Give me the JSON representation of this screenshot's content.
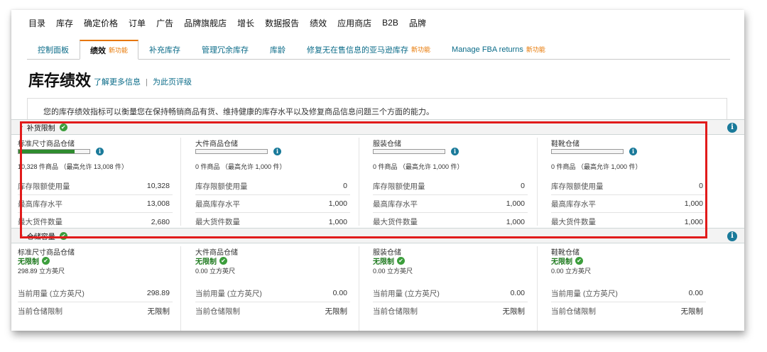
{
  "top_nav": [
    "目录",
    "库存",
    "确定价格",
    "订单",
    "广告",
    "品牌旗舰店",
    "增长",
    "数据报告",
    "绩效",
    "应用商店",
    "B2B",
    "品牌"
  ],
  "sub_tabs": [
    {
      "label": "控制面板",
      "badge": ""
    },
    {
      "label": "绩效",
      "badge": "新功能",
      "active": true
    },
    {
      "label": "补充库存",
      "badge": ""
    },
    {
      "label": "管理冗余库存",
      "badge": ""
    },
    {
      "label": "库龄",
      "badge": ""
    },
    {
      "label": "修复无在售信息的亚马逊库存",
      "badge": "新功能"
    },
    {
      "label": "Manage FBA returns",
      "badge": "新功能"
    }
  ],
  "page": {
    "title": "库存绩效",
    "link_more": "了解更多信息",
    "separator": "|",
    "link_rate": "为此页评级",
    "intro": "您的库存绩效指标可以衡量您在保持畅销商品有货、维持健康的库存水平以及修复商品信息问题三个方面的能力。"
  },
  "restock": {
    "title": "补货限制",
    "check_icon": "✔",
    "columns": [
      {
        "name": "标准尺寸商品仓储",
        "fill": 0.79,
        "summary": "10,328 件商品 （最高允许 13,008 件）",
        "metrics": [
          {
            "label": "库存限额使用量",
            "value": "10,328"
          },
          {
            "label": "最高库存水平",
            "value": "13,008"
          },
          {
            "label": "最大货件数量",
            "value": "2,680"
          }
        ]
      },
      {
        "name": "大件商品仓储",
        "fill": 0,
        "summary": "0 件商品 （最高允许 1,000 件）",
        "metrics": [
          {
            "label": "库存限额使用量",
            "value": "0"
          },
          {
            "label": "最高库存水平",
            "value": "1,000"
          },
          {
            "label": "最大货件数量",
            "value": "1,000"
          }
        ]
      },
      {
        "name": "服装仓储",
        "fill": 0,
        "summary": "0 件商品 （最高允许 1,000 件）",
        "metrics": [
          {
            "label": "库存限额使用量",
            "value": "0"
          },
          {
            "label": "最高库存水平",
            "value": "1,000"
          },
          {
            "label": "最大货件数量",
            "value": "1,000"
          }
        ]
      },
      {
        "name": "鞋靴仓储",
        "fill": 0,
        "summary": "0 件商品 （最高允许 1,000 件）",
        "metrics": [
          {
            "label": "库存限额使用量",
            "value": "0"
          },
          {
            "label": "最高库存水平",
            "value": "1,000"
          },
          {
            "label": "最大货件数量",
            "value": "1,000"
          }
        ]
      }
    ]
  },
  "storage": {
    "title": "仓储容量",
    "columns": [
      {
        "name": "标准尺寸商品仓储",
        "status": "无限制",
        "summary": "298.89 立方英尺",
        "metrics": [
          {
            "label": "当前用量 (立方英尺)",
            "value": "298.89"
          },
          {
            "label": "当前仓储限制",
            "value": "无限制"
          }
        ]
      },
      {
        "name": "大件商品仓储",
        "status": "无限制",
        "summary": "0.00 立方英尺",
        "metrics": [
          {
            "label": "当前用量 (立方英尺)",
            "value": "0.00"
          },
          {
            "label": "当前仓储限制",
            "value": "无限制"
          }
        ]
      },
      {
        "name": "服装仓储",
        "status": "无限制",
        "summary": "0.00 立方英尺",
        "metrics": [
          {
            "label": "当前用量 (立方英尺)",
            "value": "0.00"
          },
          {
            "label": "当前仓储限制",
            "value": "无限制"
          }
        ]
      },
      {
        "name": "鞋靴仓储",
        "status": "无限制",
        "summary": "0.00 立方英尺",
        "metrics": [
          {
            "label": "当前用量 (立方英尺)",
            "value": "0.00"
          },
          {
            "label": "当前仓储限制",
            "value": "无限制"
          }
        ]
      }
    ]
  },
  "icons": {
    "info": "i",
    "check": "✔",
    "chevron": "^"
  },
  "colors": {
    "accent": "#e77600",
    "link": "#0a6b88",
    "ok": "#3c9e3c",
    "highlight": "#e11b1b"
  }
}
